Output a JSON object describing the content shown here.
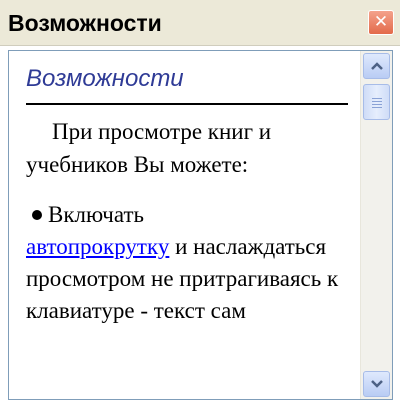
{
  "window": {
    "title": "Возможности",
    "close_glyph": "✕"
  },
  "content": {
    "heading": "Возможности",
    "paragraph1": "При просмотре книг и учебников Вы можете:",
    "bullet": {
      "text_before_link": "Включать",
      "link_text": "автопрокрутку",
      "text_after_link": " и наслаждаться просмотром не притрагиваясь к клавиатуре - текст сам"
    }
  },
  "scrollbar": {
    "up_icon": "arrow-up",
    "down_icon": "arrow-down"
  },
  "colors": {
    "heading": "#2f3b96",
    "link": "#0000ff",
    "close_button": "#e36a4a"
  }
}
